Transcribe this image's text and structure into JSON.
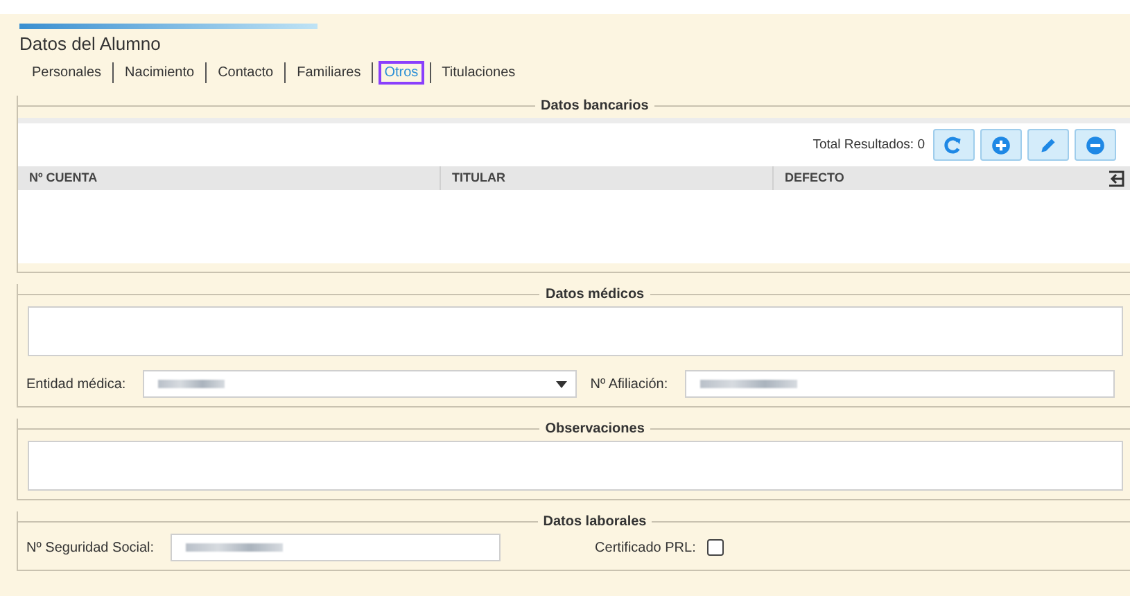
{
  "header": {
    "title": "Datos del Alumno"
  },
  "tabs": [
    {
      "label": "Personales",
      "selected": false
    },
    {
      "label": "Nacimiento",
      "selected": false
    },
    {
      "label": "Contacto",
      "selected": false
    },
    {
      "label": "Familiares",
      "selected": false
    },
    {
      "label": "Otros",
      "selected": true
    },
    {
      "label": "Titulaciones",
      "selected": false
    }
  ],
  "bank": {
    "legend": "Datos bancarios",
    "total": "Total Resultados: 0",
    "columns": [
      "Nº CUENTA",
      "TITULAR",
      "DEFECTO"
    ]
  },
  "medical": {
    "legend": "Datos médicos",
    "entity_label": "Entidad médica:",
    "entity_redacted": true,
    "affiliation_label": "Nº Afiliación:",
    "affiliation_redacted": true
  },
  "notes": {
    "legend": "Observaciones"
  },
  "work": {
    "legend": "Datos laborales",
    "ss_label": "Nº Seguridad Social:",
    "ss_redacted": true,
    "prl_label": "Certificado PRL:",
    "prl_checked": false
  }
}
